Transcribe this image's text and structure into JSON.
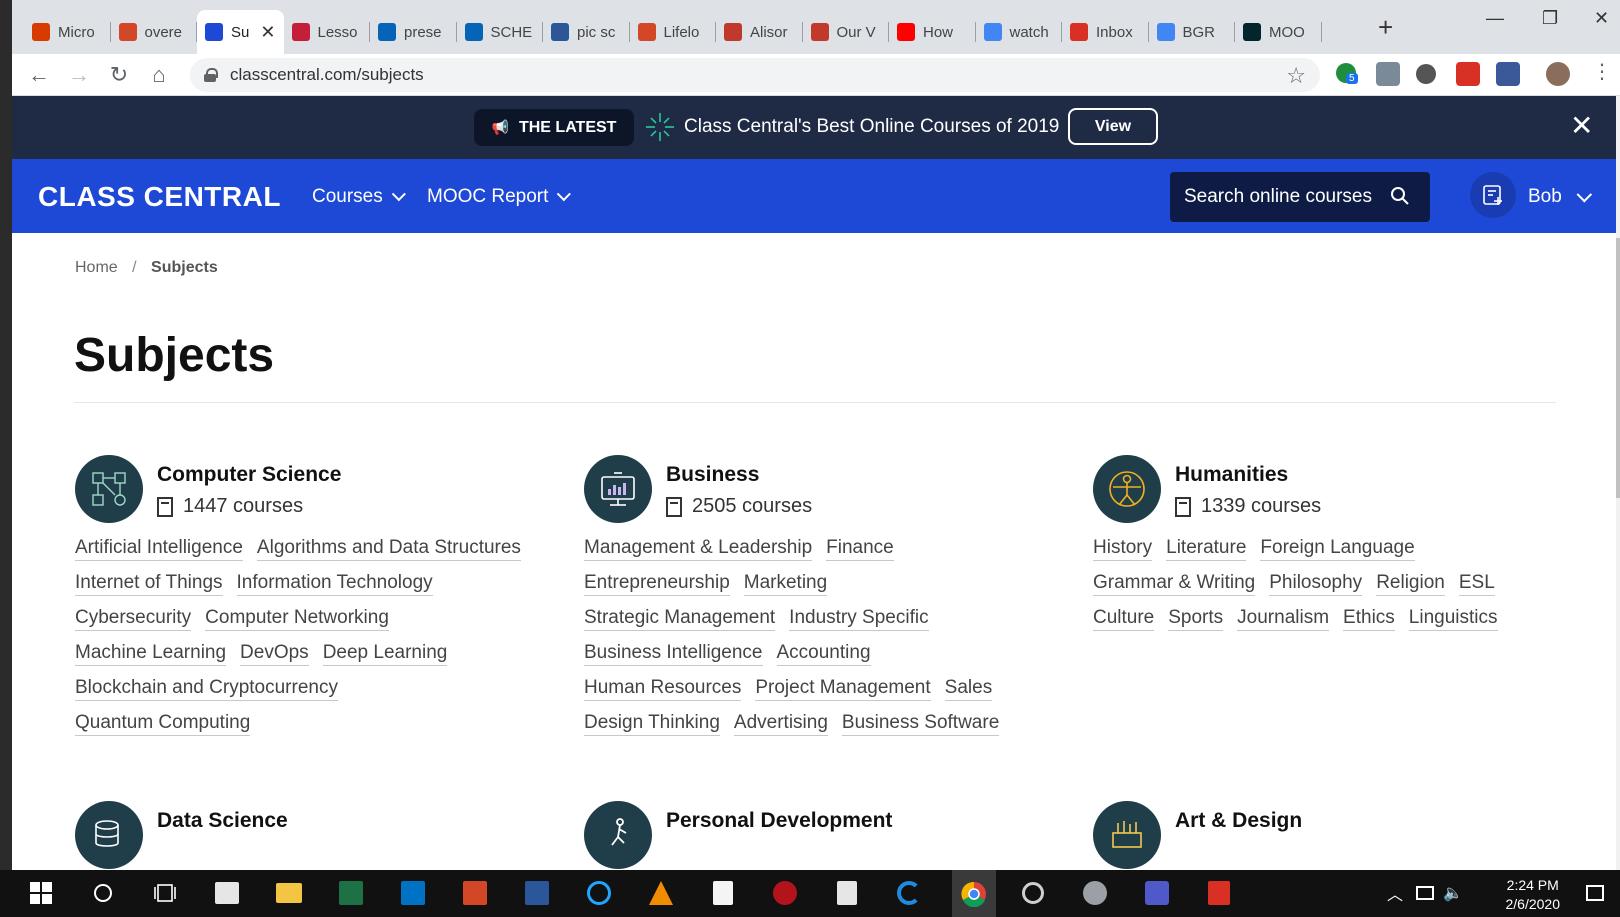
{
  "tabs": [
    {
      "label": "Micro",
      "color": "#d83b01"
    },
    {
      "label": "overe",
      "color": "#d24726"
    },
    {
      "label": "Su",
      "color": "#1e48d6",
      "active": true
    },
    {
      "label": "Lesso",
      "color": "#c41e3a"
    },
    {
      "label": "prese",
      "color": "#0364b8"
    },
    {
      "label": "SCHE",
      "color": "#0364b8"
    },
    {
      "label": "pic sc",
      "color": "#2b579a"
    },
    {
      "label": "Lifelo",
      "color": "#d24726"
    },
    {
      "label": "Alisor",
      "color": "#c0392b"
    },
    {
      "label": "Our V",
      "color": "#c0392b"
    },
    {
      "label": "How",
      "color": "#ff0000"
    },
    {
      "label": "watch",
      "color": "#4285f4"
    },
    {
      "label": "Inbox",
      "color": "#d93025"
    },
    {
      "label": "BGR",
      "color": "#4285f4"
    },
    {
      "label": "MOO",
      "color": "#02262b"
    }
  ],
  "tab_close": "✕",
  "new_tab": "+",
  "address": "classcentral.com/subjects",
  "ext_badge": "5",
  "banner": {
    "pill": "THE LATEST",
    "text": "Class Central's Best Online Courses of 2019",
    "button": "View",
    "close": "✕"
  },
  "nav": {
    "logo": "CLASS CENTRAL",
    "courses": "Courses",
    "mooc": "MOOC Report",
    "search_placeholder": "Search online courses",
    "user": "Bob"
  },
  "breadcrumb": {
    "home": "Home",
    "sep": "/",
    "current": "Subjects"
  },
  "title": "Subjects",
  "subjects": [
    {
      "name": "Computer Science",
      "count": "1447 courses",
      "links": [
        "Artificial Intelligence",
        "Algorithms and Data Structures",
        "Internet of Things",
        "Information Technology",
        "Cybersecurity",
        "Computer Networking",
        "Machine Learning",
        "DevOps",
        "Deep Learning",
        "Blockchain and Cryptocurrency",
        "Quantum Computing"
      ]
    },
    {
      "name": "Business",
      "count": "2505 courses",
      "links": [
        "Management & Leadership",
        "Finance",
        "Entrepreneurship",
        "Marketing",
        "Strategic Management",
        "Industry Specific",
        "Business Intelligence",
        "Accounting",
        "Human Resources",
        "Project Management",
        "Sales",
        "Design Thinking",
        "Advertising",
        "Business Software"
      ]
    },
    {
      "name": "Humanities",
      "count": "1339 courses",
      "links": [
        "History",
        "Literature",
        "Foreign Language",
        "Grammar & Writing",
        "Philosophy",
        "Religion",
        "ESL",
        "Culture",
        "Sports",
        "Journalism",
        "Ethics",
        "Linguistics"
      ]
    },
    {
      "name": "Data Science",
      "count": "",
      "links": []
    },
    {
      "name": "Personal Development",
      "count": "",
      "links": []
    },
    {
      "name": "Art & Design",
      "count": "",
      "links": []
    }
  ],
  "clock": {
    "time": "2:24 PM",
    "date": "2/6/2020"
  }
}
